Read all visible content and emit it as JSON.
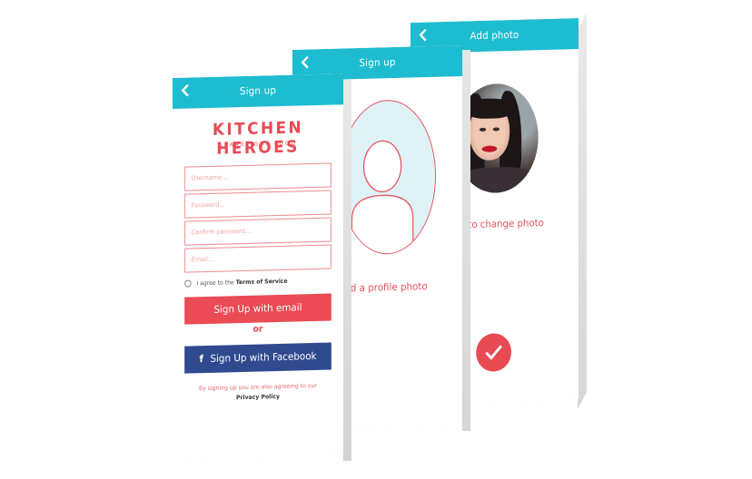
{
  "screens": {
    "signup": {
      "back_icon": "chevron-left-icon",
      "header_title": "Sign up",
      "logo": "KITCHEN HEROES",
      "tagline": "SHARE YOUR FOOD",
      "username_placeholder": "Username...",
      "password_placeholder": "Password...",
      "confirm_placeholder": "Confirm password...",
      "email_placeholder": "Email...",
      "terms_prefix": "I agree to the",
      "terms_link": "Terms of Service",
      "email_button": "Sign Up with email",
      "or_text": "or",
      "facebook_icon": "f",
      "facebook_button": "Sign Up with Facebook",
      "fine_print": "By signing up you are also agreeing to our",
      "privacy_link": "Privacy Policy"
    },
    "profile_photo": {
      "header_title": "Sign up",
      "add_text": "to add a profile photo"
    },
    "add_photo": {
      "header_title": "Add photo",
      "change_text": ": to change photo"
    }
  },
  "colors": {
    "header": "#1ebcd0",
    "accent": "#ea4b55",
    "facebook": "#2f4a8f"
  }
}
